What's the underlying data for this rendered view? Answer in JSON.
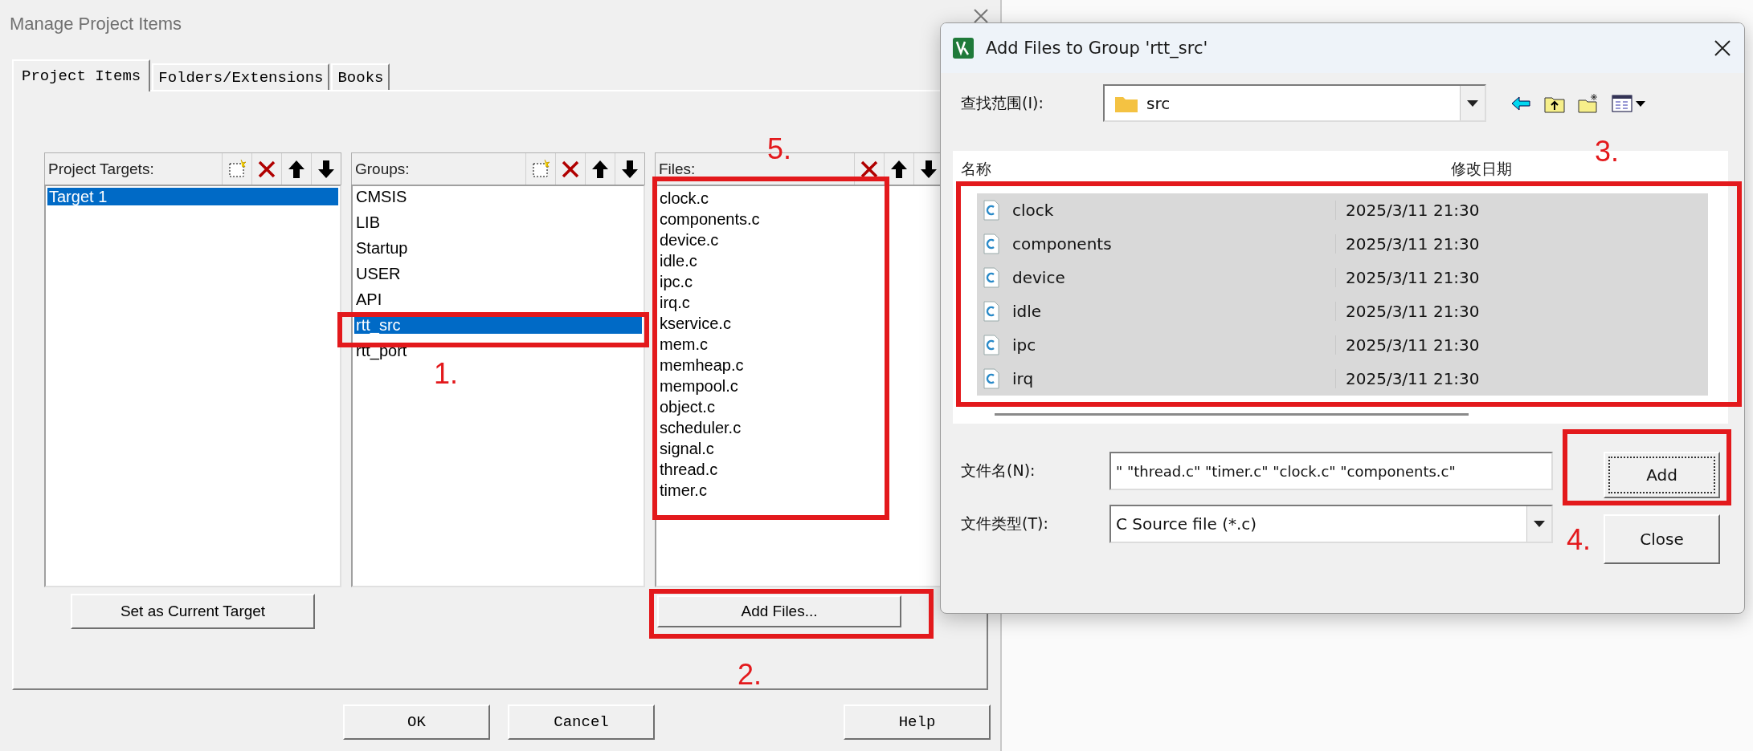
{
  "manage_dialog": {
    "title": "Manage Project Items",
    "tabs": [
      {
        "label": "Project Items",
        "selected": true
      },
      {
        "label": "Folders/Extensions",
        "selected": false
      },
      {
        "label": "Books",
        "selected": false
      }
    ],
    "targets_panel": {
      "label": "Project Targets:",
      "items": [
        {
          "label": "Target 1",
          "selected": true
        }
      ]
    },
    "groups_panel": {
      "label": "Groups:",
      "items": [
        {
          "label": "CMSIS",
          "selected": false
        },
        {
          "label": "LIB",
          "selected": false
        },
        {
          "label": "Startup",
          "selected": false
        },
        {
          "label": "USER",
          "selected": false
        },
        {
          "label": "API",
          "selected": false
        },
        {
          "label": "rtt_src",
          "selected": true
        },
        {
          "label": "rtt_port",
          "selected": false
        }
      ]
    },
    "files_panel": {
      "label": "Files:",
      "items": [
        "clock.c",
        "components.c",
        "device.c",
        "idle.c",
        "ipc.c",
        "irq.c",
        "kservice.c",
        "mem.c",
        "memheap.c",
        "mempool.c",
        "object.c",
        "scheduler.c",
        "signal.c",
        "thread.c",
        "timer.c"
      ]
    },
    "set_current_button": "Set as Current Target",
    "add_files_button": "Add Files...",
    "buttons": [
      "OK",
      "Cancel",
      "Help"
    ]
  },
  "add_dialog": {
    "title": "Add Files to Group 'rtt_src'",
    "look_in_label": "查找范围(I):",
    "look_in_value": "src",
    "columns": [
      "名称",
      "修改日期"
    ],
    "files": [
      {
        "name": "clock",
        "modified": "2025/3/11 21:30",
        "selected": true
      },
      {
        "name": "components",
        "modified": "2025/3/11 21:30",
        "selected": true
      },
      {
        "name": "device",
        "modified": "2025/3/11 21:30",
        "selected": true
      },
      {
        "name": "idle",
        "modified": "2025/3/11 21:30",
        "selected": true
      },
      {
        "name": "ipc",
        "modified": "2025/3/11 21:30",
        "selected": true
      },
      {
        "name": "irq",
        "modified": "2025/3/11 21:30",
        "selected": true
      }
    ],
    "filename_label": "文件名(N):",
    "filename_value": "\" \"thread.c\" \"timer.c\" \"clock.c\" \"components.c\"",
    "filetype_label": "文件类型(T):",
    "filetype_value": "C Source file (*.c)",
    "buttons": [
      {
        "label": "Add",
        "focused": true
      },
      {
        "label": "Close",
        "focused": false
      }
    ]
  },
  "annotations": [
    "1.",
    "2.",
    "3.",
    "4.",
    "5."
  ]
}
